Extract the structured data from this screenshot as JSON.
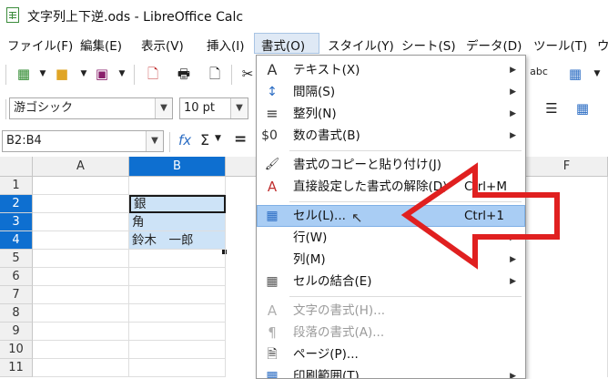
{
  "window": {
    "title": "文字列上下逆.ods - LibreOffice Calc"
  },
  "menubar": [
    {
      "label": "ファイル(F)"
    },
    {
      "label": "編集(E)"
    },
    {
      "label": "表示(V)"
    },
    {
      "label": "挿入(I)"
    },
    {
      "label": "書式(O)"
    },
    {
      "label": "スタイル(Y)"
    },
    {
      "label": "シート(S)"
    },
    {
      "label": "データ(D)"
    },
    {
      "label": "ツール(T)"
    },
    {
      "label": "ウ"
    }
  ],
  "toolbar2": {
    "font_name": "游ゴシック",
    "font_size": "10 pt"
  },
  "formula_bar": {
    "name_box": "B2:B4",
    "fx": "fx",
    "sum": "Σ",
    "equals": "="
  },
  "grid": {
    "columns": [
      "A",
      "B",
      "F"
    ],
    "rows": [
      "1",
      "2",
      "3",
      "4",
      "5",
      "6",
      "7",
      "8",
      "9",
      "10",
      "11"
    ],
    "cells": {
      "B2": "銀",
      "B3": "角",
      "B4": "鈴木　一郎"
    }
  },
  "format_menu": {
    "items": [
      {
        "label": "テキスト(X)",
        "icon": "text-icon",
        "glyph": "A"
      },
      {
        "label": "間隔(S)",
        "icon": "spacing-icon",
        "glyph": "↕"
      },
      {
        "label": "整列(N)",
        "icon": "align-icon",
        "glyph": "≡"
      },
      {
        "label": "数の書式(B)",
        "icon": "number-format-icon",
        "glyph": "$0"
      },
      {
        "label": "書式のコピーと貼り付け(J)",
        "icon": "clone-formatting-icon",
        "glyph": "🖌"
      },
      {
        "label": "直接設定した書式の解除(D)",
        "shortcut": "Ctrl+M",
        "icon": "clear-formatting-icon",
        "glyph": "A"
      },
      {
        "label": "セル(L)...",
        "shortcut": "Ctrl+1",
        "icon": "format-cells-icon",
        "glyph": "▦"
      },
      {
        "label": "行(W)",
        "icon": "row-icon",
        "glyph": ""
      },
      {
        "label": "列(M)",
        "icon": "column-icon",
        "glyph": ""
      },
      {
        "label": "セルの結合(E)",
        "icon": "merge-cells-icon",
        "glyph": "▦"
      },
      {
        "label": "文字の書式(H)...",
        "icon": "character-icon",
        "glyph": "A"
      },
      {
        "label": "段落の書式(A)...",
        "icon": "paragraph-icon",
        "glyph": "¶"
      },
      {
        "label": "ページ(P)...",
        "icon": "page-icon",
        "glyph": "🗎"
      },
      {
        "label": "印刷範囲(T)",
        "icon": "print-range-icon",
        "glyph": "▦"
      }
    ]
  },
  "colors": {
    "selection": "#0e6fd0",
    "highlight": "#a9cdf4",
    "arrow": "#e02020"
  }
}
